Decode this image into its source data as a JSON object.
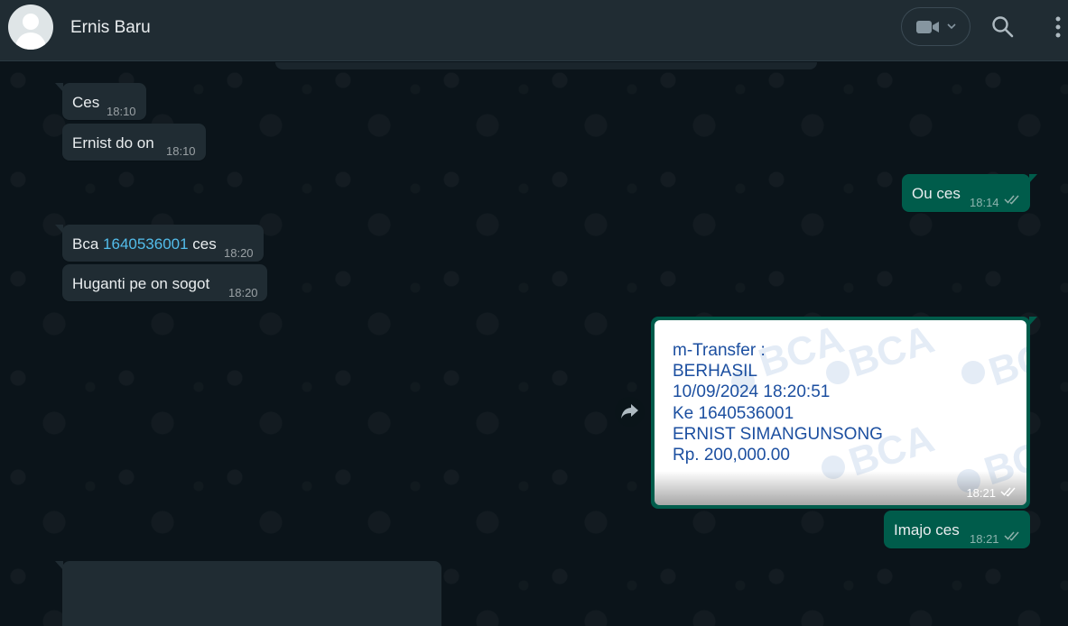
{
  "header": {
    "contact_name": "Ernis Baru"
  },
  "icons": {
    "video": "video-camera-icon",
    "search": "search-icon",
    "menu": "vertical-dots-menu-icon",
    "forward": "forward-arrow-icon",
    "read_receipt": "double-check-icon"
  },
  "messages": {
    "m1": {
      "text": "Ces",
      "time": "18:10"
    },
    "m2": {
      "text": "Ernist do on",
      "time": "18:10"
    },
    "m3": {
      "text": "Ou ces",
      "time": "18:14"
    },
    "m4": {
      "prefix": "Bca ",
      "link": "1640536001",
      "suffix": " ces",
      "time": "18:20"
    },
    "m5": {
      "text": "Huganti pe on sogot",
      "time": "18:20"
    },
    "m6": {
      "image_lines": [
        "m-Transfer :",
        "BERHASIL",
        "10/09/2024 18:20:51",
        "Ke 1640536001",
        "ERNIST SIMANGUNSONG",
        "Rp. 200,000.00"
      ],
      "watermark": "BCA",
      "time": "18:21"
    },
    "m7": {
      "text": "Imajo ces",
      "time": "18:21"
    }
  },
  "colors": {
    "incoming_bubble": "#202c33",
    "outgoing_bubble": "#005c4b",
    "link": "#53bdeb",
    "read_ticks": "#53bdeb",
    "receipt_text": "#1c4fa0"
  }
}
